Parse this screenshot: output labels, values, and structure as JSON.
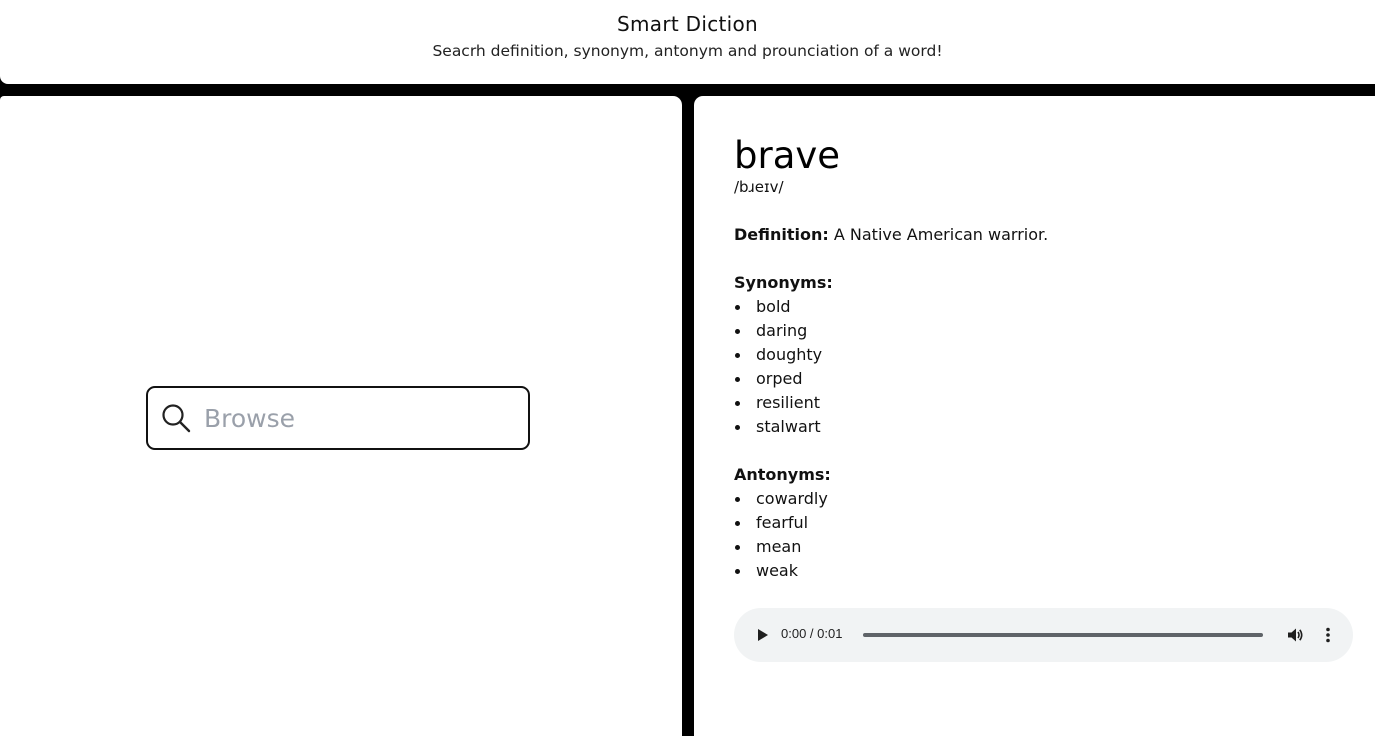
{
  "header": {
    "title": "Smart Diction",
    "subtitle": "Seacrh definition, synonym, antonym and prounciation of a word!"
  },
  "search": {
    "placeholder": "Browse",
    "value": "",
    "icon": "search-icon"
  },
  "result": {
    "word": "brave",
    "phonetic": "/bɹeɪv/",
    "definition_label": "Definition:",
    "definition": "A Native American warrior.",
    "synonyms_label": "Synonyms:",
    "synonyms": [
      "bold",
      "daring",
      "doughty",
      "orped",
      "resilient",
      "stalwart"
    ],
    "antonyms_label": "Antonyms:",
    "antonyms": [
      "cowardly",
      "fearful",
      "mean",
      "weak"
    ]
  },
  "audio": {
    "time": "0:00 / 0:01",
    "progress": 0,
    "icons": [
      "play-icon",
      "volume-icon",
      "more-vert-icon"
    ]
  },
  "colors": {
    "background": "#000000",
    "panel": "#ffffff",
    "player_bg": "#f1f3f4",
    "placeholder": "#9aa0aa"
  }
}
